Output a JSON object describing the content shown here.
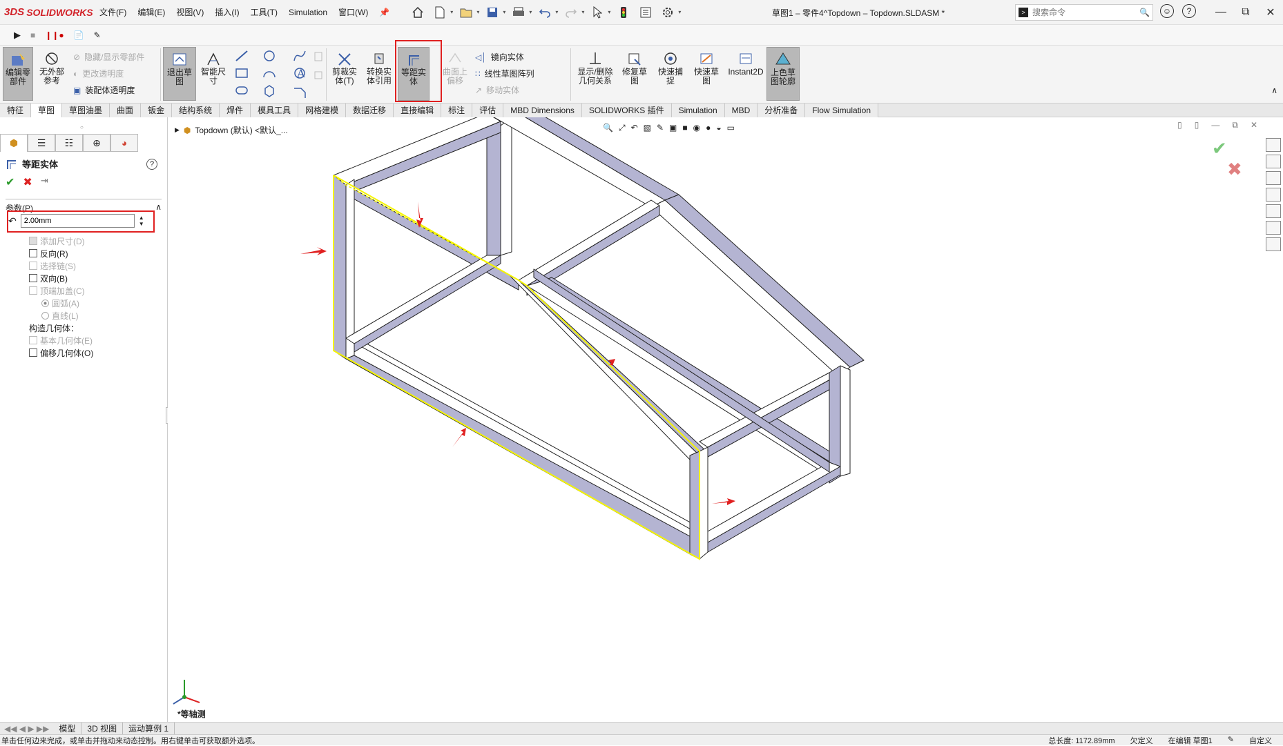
{
  "app": {
    "logo_prefix": "3DS",
    "logo_text": "SOLIDWORKS",
    "doc_title": "草图1 – 零件4^Topdown – Topdown.SLDASM *"
  },
  "menu": [
    "文件(F)",
    "编辑(E)",
    "视图(V)",
    "插入(I)",
    "工具(T)",
    "Simulation",
    "窗口(W)"
  ],
  "search": {
    "placeholder": "搜索命令"
  },
  "ribbon": {
    "edit_part": "编辑零\n部件",
    "no_external": "无外部\n参考",
    "hide_show": "隐藏/显示零部件",
    "change_transparency": "更改透明度",
    "assembly_transparency": "装配体透明度",
    "exit_sketch": "退出草\n图",
    "smart_dim": "智能尺\n寸",
    "trim": "剪裁实\n体(T)",
    "convert": "转换实\n体引用",
    "offset": "等距实\n体",
    "offset_surface": "曲面上\n偏移",
    "mirror": "镜向实体",
    "linear_pattern": "线性草图阵列",
    "move": "移动实体",
    "display_relations": "显示/删除\n几何关系",
    "repair": "修复草\n图",
    "quick_snap": "快速捕\n捉",
    "rapid_sketch": "快速草\n图",
    "instant2d": "Instant2D",
    "shaded_contour": "上色草\n图轮廓"
  },
  "tabs": [
    "特征",
    "草图",
    "草图油墨",
    "曲面",
    "钣金",
    "结构系统",
    "焊件",
    "模具工具",
    "网格建模",
    "数据迁移",
    "直接编辑",
    "标注",
    "评估",
    "MBD Dimensions",
    "SOLIDWORKS 插件",
    "Simulation",
    "MBD",
    "分析准备",
    "Flow Simulation"
  ],
  "property_manager": {
    "title": "等距实体",
    "section": "参数(P)",
    "offset_value": "2.00mm",
    "options": [
      {
        "label": "添加尺寸(D)",
        "enabled": false,
        "checked": true
      },
      {
        "label": "反向(R)",
        "enabled": true,
        "checked": false
      },
      {
        "label": "选择链(S)",
        "enabled": false,
        "checked": false
      },
      {
        "label": "双向(B)",
        "enabled": true,
        "checked": false
      },
      {
        "label": "顶端加盖(C)",
        "enabled": false,
        "checked": false
      }
    ],
    "cap_arc": "圆弧(A)",
    "cap_line": "直线(L)",
    "construction_label": "构造几何体：",
    "base_geometry": "基本几何体(E)",
    "offset_geometry": "偏移几何体(O)"
  },
  "viewport": {
    "tree_label": "Topdown (默认) <默认_...",
    "view_name": "*等轴测",
    "frame_color": "#b4b4d2",
    "edge_color": "#222222",
    "selection_color": "#f5f500",
    "arrow_color": "#e02020"
  },
  "bottom_tabs": [
    "模型",
    "3D 视图",
    "运动算例 1"
  ],
  "status": {
    "message": "单击任何边来完成，或单击并拖动来动态控制。用右键单击可获取额外选项。",
    "length": "总长度: 1172.89mm",
    "defined": "欠定义",
    "editing": "在编辑 草图1",
    "custom": "自定义"
  }
}
